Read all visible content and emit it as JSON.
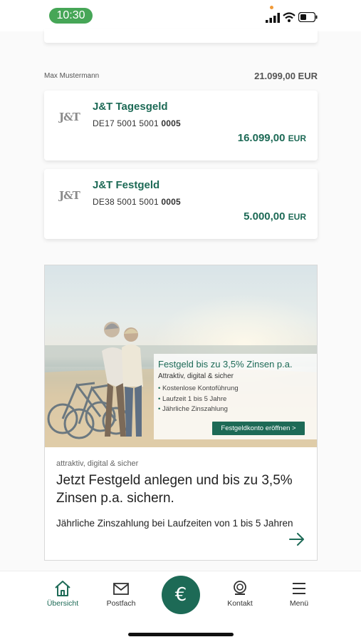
{
  "status_bar": {
    "time": "10:30",
    "icons": [
      "signal-icon",
      "wifi-icon",
      "battery-icon"
    ]
  },
  "owner": {
    "name": "Max Mustermann",
    "total": "21.099,00 EUR"
  },
  "accounts": [
    {
      "logo": "J&T",
      "name": "J&T Tagesgeld",
      "iban_prefix": "DE17 5001 5001 ",
      "iban_suffix": "0005",
      "balance": "16.099,00",
      "currency": "EUR"
    },
    {
      "logo": "J&T",
      "name": "J&T Festgeld",
      "iban_prefix": "DE38 5001 5001 ",
      "iban_suffix": "0005",
      "balance": "5.000,00",
      "currency": "EUR"
    }
  ],
  "promo": {
    "overlay_title": "Festgeld bis zu 3,5% Zinsen p.a.",
    "overlay_subtitle": "Attraktiv, digital & sicher",
    "overlay_points": [
      "Kostenlose Kontoführung",
      "Laufzeit 1 bis 5 Jahre",
      "Jährliche Zinszahlung"
    ],
    "overlay_button": "Festgeldkonto eröffnen >",
    "kicker": "attraktiv, digital & sicher",
    "headline": "Jetzt Festgeld anlegen und bis zu 3,5% Zinsen p.a. sichern.",
    "body": "Jährliche Zinszahlung bei Laufzeiten von 1 bis 5 Jahren"
  },
  "nav": {
    "home": "Übersicht",
    "mail": "Postfach",
    "center_icon": "€",
    "contact": "Kontakt",
    "menu": "Menü"
  },
  "colors": {
    "accent": "#1d6a56",
    "status_pill": "#46a657"
  }
}
